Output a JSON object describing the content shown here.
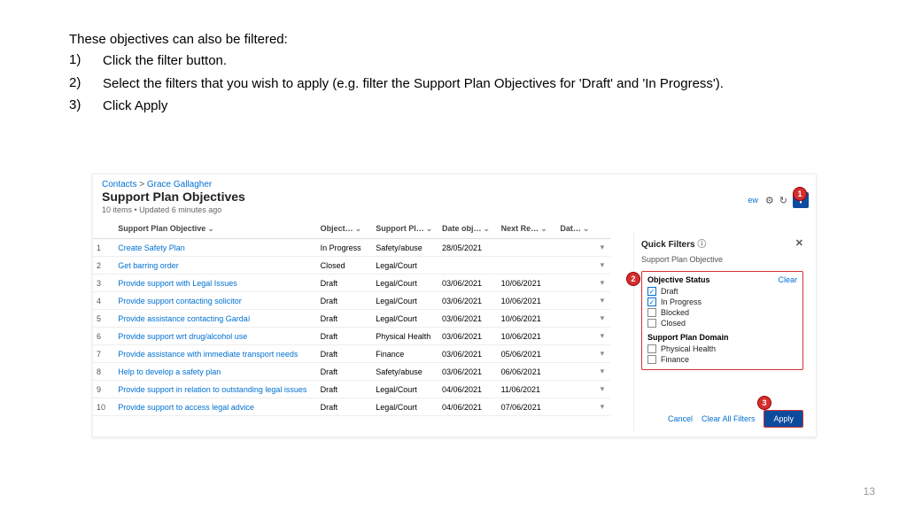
{
  "instructions": {
    "intro": "These objectives can also be filtered:",
    "steps": [
      "Click the filter button.",
      "Select the filters that you wish to apply (e.g. filter the Support Plan Objectives for 'Draft' and 'In Progress').",
      "Click Apply"
    ]
  },
  "breadcrumb": {
    "root": "Contacts",
    "sep": ">",
    "leaf": "Grace Gallagher"
  },
  "page_title": "Support Plan Objectives",
  "subtitle": "10 items • Updated 6 minutes ago",
  "toolbar": {
    "new_label": "ew",
    "gear": "⚙",
    "refresh": "↻"
  },
  "columns": {
    "c0": "",
    "c1": "Support Plan Objective",
    "c2": "Object…",
    "c3": "Support Pl…",
    "c4": "Date obj…",
    "c5": "Next Re…",
    "c6": "Dat…",
    "c7": ""
  },
  "rows": [
    {
      "n": "1",
      "obj": "Create Safety Plan",
      "status": "In Progress",
      "domain": "Safety/abuse",
      "date": "28/05/2021",
      "next": "",
      "dd": "▾"
    },
    {
      "n": "2",
      "obj": "Get barring order",
      "status": "Closed",
      "domain": "Legal/Court",
      "date": "",
      "next": "",
      "dd": "▾"
    },
    {
      "n": "3",
      "obj": "Provide support with Legal Issues",
      "status": "Draft",
      "domain": "Legal/Court",
      "date": "03/06/2021",
      "next": "10/06/2021",
      "dd": "▾"
    },
    {
      "n": "4",
      "obj": "Provide support contacting solicitor",
      "status": "Draft",
      "domain": "Legal/Court",
      "date": "03/06/2021",
      "next": "10/06/2021",
      "dd": "▾"
    },
    {
      "n": "5",
      "obj": "Provide assistance contacting Gardaí",
      "status": "Draft",
      "domain": "Legal/Court",
      "date": "03/06/2021",
      "next": "10/06/2021",
      "dd": "▾"
    },
    {
      "n": "6",
      "obj": "Provide support wrt drug/alcohol use",
      "status": "Draft",
      "domain": "Physical Health",
      "date": "03/06/2021",
      "next": "10/06/2021",
      "dd": "▾"
    },
    {
      "n": "7",
      "obj": "Provide assistance with immediate transport needs",
      "status": "Draft",
      "domain": "Finance",
      "date": "03/06/2021",
      "next": "05/06/2021",
      "dd": "▾"
    },
    {
      "n": "8",
      "obj": "Help to develop a safety plan",
      "status": "Draft",
      "domain": "Safety/abuse",
      "date": "03/06/2021",
      "next": "06/06/2021",
      "dd": "▾"
    },
    {
      "n": "9",
      "obj": "Provide support in relation to outstanding legal issues",
      "status": "Draft",
      "domain": "Legal/Court",
      "date": "04/06/2021",
      "next": "11/06/2021",
      "dd": "▾"
    },
    {
      "n": "10",
      "obj": "Provide support to access legal advice",
      "status": "Draft",
      "domain": "Legal/Court",
      "date": "04/06/2021",
      "next": "07/06/2021",
      "dd": "▾"
    }
  ],
  "filters": {
    "title": "Quick Filters",
    "info": "ⓘ",
    "close": "✕",
    "group_label": "Support Plan Objective",
    "status": {
      "heading": "Objective Status",
      "clear": "Clear",
      "options": [
        {
          "label": "Draft",
          "checked": true
        },
        {
          "label": "In Progress",
          "checked": true
        },
        {
          "label": "Blocked",
          "checked": false
        },
        {
          "label": "Closed",
          "checked": false
        }
      ]
    },
    "domain": {
      "heading": "Support Plan Domain",
      "options": [
        {
          "label": "Physical Health",
          "checked": false
        },
        {
          "label": "Finance",
          "checked": false
        }
      ]
    },
    "footer": {
      "cancel": "Cancel",
      "clear_all": "Clear All Filters",
      "apply": "Apply"
    }
  },
  "callouts": {
    "c1": "1",
    "c2": "2",
    "c3": "3"
  },
  "page_number": "13"
}
